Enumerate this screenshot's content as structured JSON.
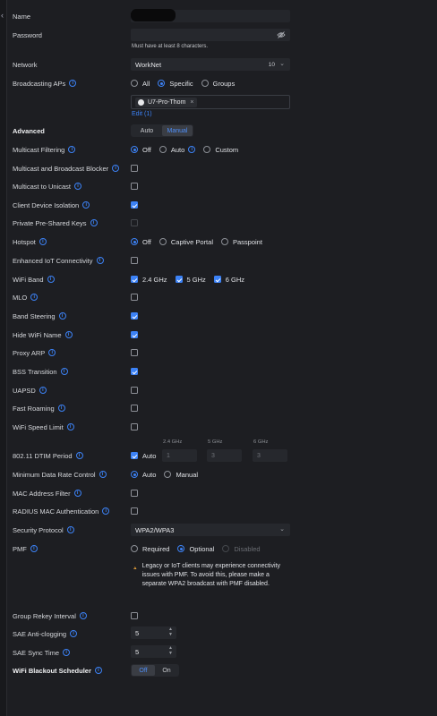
{
  "nav": {
    "back_glyph": "‹"
  },
  "name": {
    "label": "Name"
  },
  "password": {
    "label": "Password",
    "hint": "Must have at least 8 characters."
  },
  "network": {
    "label": "Network",
    "value": "WorkNet",
    "suffix": "10"
  },
  "broadcasting": {
    "label": "Broadcasting APs",
    "options": [
      "All",
      "Specific",
      "Groups"
    ],
    "selected": "Specific",
    "ap_chip": "U7-Pro-Thom",
    "edit_link": "Edit (1)"
  },
  "advanced": {
    "label": "Advanced",
    "auto": "Auto",
    "manual": "Manual",
    "selected": "Manual"
  },
  "multicast_filtering": {
    "label": "Multicast Filtering",
    "options": [
      "Off",
      "Auto",
      "Custom"
    ],
    "selected": "Off"
  },
  "multicast_broadcast_blocker": {
    "label": "Multicast and Broadcast Blocker"
  },
  "multicast_to_unicast": {
    "label": "Multicast to Unicast"
  },
  "client_device_isolation": {
    "label": "Client Device Isolation"
  },
  "private_psk": {
    "label": "Private Pre-Shared Keys"
  },
  "hotspot": {
    "label": "Hotspot",
    "options": [
      "Off",
      "Captive Portal",
      "Passpoint"
    ],
    "selected": "Off"
  },
  "enhanced_iot": {
    "label": "Enhanced IoT Connectivity"
  },
  "wifi_band": {
    "label": "WiFi Band",
    "bands": [
      "2.4 GHz",
      "5 GHz",
      "6 GHz"
    ]
  },
  "mlo": {
    "label": "MLO"
  },
  "band_steering": {
    "label": "Band Steering"
  },
  "hide_wifi_name": {
    "label": "Hide WiFi Name"
  },
  "proxy_arp": {
    "label": "Proxy ARP"
  },
  "bss_transition": {
    "label": "BSS Transition"
  },
  "uapsd": {
    "label": "UAPSD"
  },
  "fast_roaming": {
    "label": "Fast Roaming"
  },
  "wifi_speed_limit": {
    "label": "WiFi Speed Limit"
  },
  "dtim": {
    "label": "802.11 DTIM Period",
    "auto": "Auto",
    "headers": [
      "2.4 GHz",
      "5 GHz",
      "6 GHz"
    ],
    "values": [
      "1",
      "3",
      "3"
    ]
  },
  "min_data_rate": {
    "label": "Minimum Data Rate Control",
    "options": [
      "Auto",
      "Manual"
    ],
    "selected": "Auto"
  },
  "mac_filter": {
    "label": "MAC Address Filter"
  },
  "radius_mac": {
    "label": "RADIUS MAC Authentication"
  },
  "security_protocol": {
    "label": "Security Protocol",
    "value": "WPA2/WPA3"
  },
  "pmf": {
    "label": "PMF",
    "options": [
      "Required",
      "Optional",
      "Disabled"
    ],
    "selected": "Optional",
    "warning": "Legacy or IoT clients may experience connectivity issues with PMF. To avoid this, please make a separate WPA2 broadcast with PMF disabled."
  },
  "group_rekey": {
    "label": "Group Rekey Interval"
  },
  "sae_anti_clogging": {
    "label": "SAE Anti-clogging",
    "value": "5"
  },
  "sae_sync_time": {
    "label": "SAE Sync Time",
    "value": "5"
  },
  "blackout": {
    "label": "WiFi Blackout Scheduler",
    "off": "Off",
    "on": "On",
    "selected": "Off"
  },
  "info_glyph": "i",
  "stepper_glyph": "▲\n▼",
  "chevron_glyph": "⌄",
  "close_glyph": "×",
  "colors": {
    "accent": "#3c82f6",
    "background": "#1d1e22",
    "warning": "#e8a23a"
  }
}
